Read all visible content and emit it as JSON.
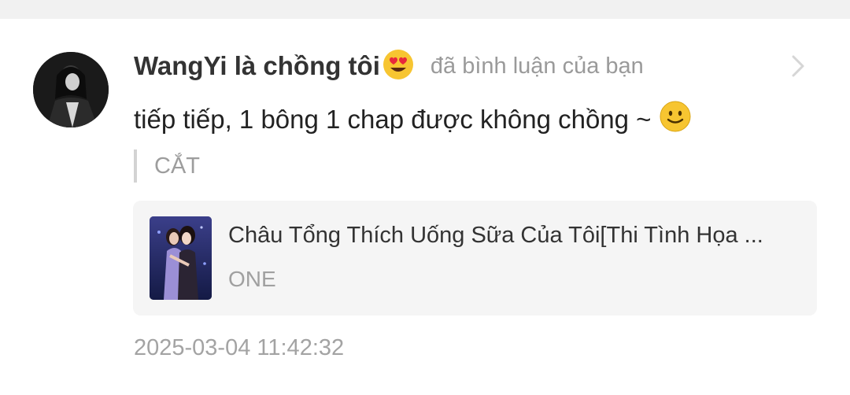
{
  "notification": {
    "username": "WangYi là chồng tôi",
    "username_emoji": "heart-eyes-emoji",
    "action_text": "đã bình luận của bạn",
    "comment_text": "tiếp tiếp, 1 bông 1 chap được không chồng ~",
    "comment_emoji": "smile-emoji",
    "quote_text": "CẮT",
    "work": {
      "title": "Châu Tổng Thích Uống Sữa Của Tôi[Thi Tình Họa ...",
      "author": "ONE"
    },
    "timestamp": "2025-03-04 11:42:32"
  },
  "icons": {
    "chevron": "chevron-right-icon"
  },
  "colors": {
    "background": "#f1f1f1",
    "card": "#ffffff",
    "username": "#333333",
    "secondary_text": "#9a9a9a",
    "work_card_bg": "#f5f5f5",
    "emoji_yellow": "#f7c531"
  }
}
